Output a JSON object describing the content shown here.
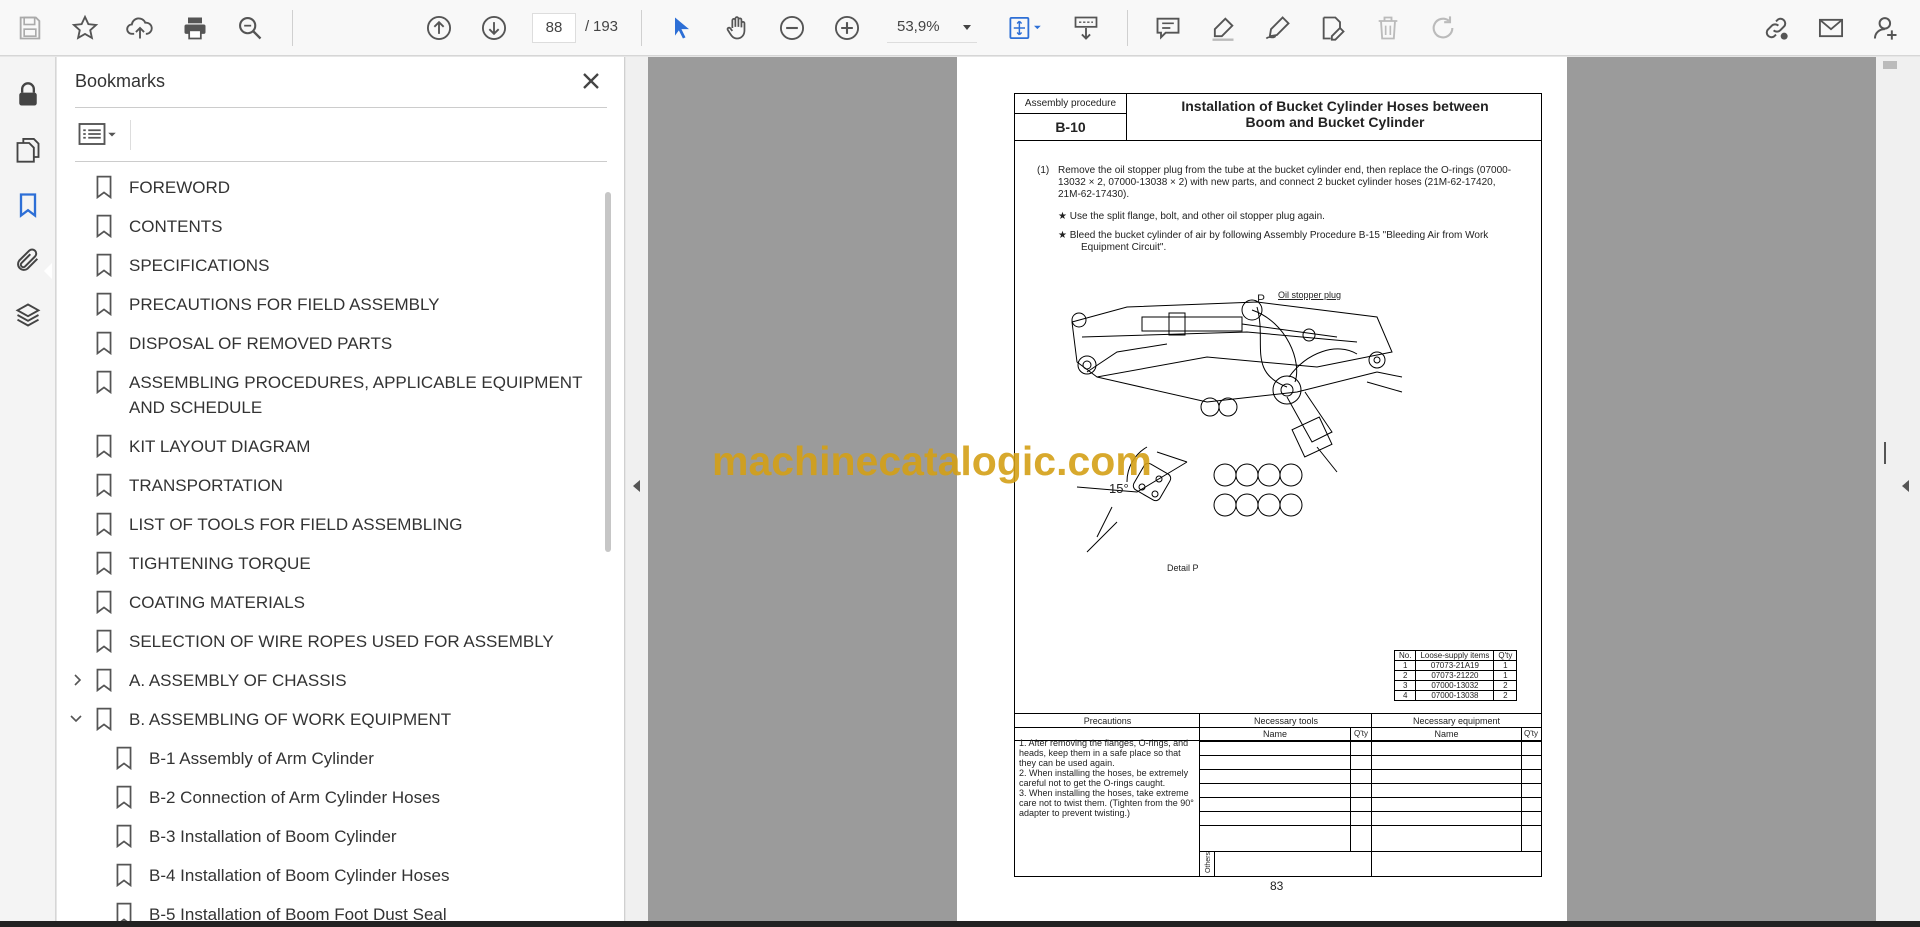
{
  "toolbar": {
    "page_current": "88",
    "page_separator": "/",
    "page_total": "193",
    "zoom": "53,9%",
    "icons": [
      "save-icon",
      "star-icon",
      "upload-icon",
      "print-icon",
      "zoom-search-icon",
      "page-up-icon",
      "page-down-icon",
      "zoom-out-icon",
      "zoom-in-icon",
      "select-arrow-icon",
      "hand-icon",
      "fit-page-icon",
      "scroll-mode-icon",
      "comment-icon",
      "highlight-icon",
      "sign-icon",
      "edit-icon",
      "delete-icon",
      "redo-icon",
      "share-link-icon",
      "email-icon",
      "account-icon"
    ]
  },
  "rail": {
    "icons": [
      "lock-icon",
      "pages-icon",
      "bookmark-icon",
      "attachment-icon",
      "layers-icon"
    ]
  },
  "bookmarks": {
    "title": "Bookmarks",
    "items": [
      {
        "label": "FOREWORD",
        "level": 0
      },
      {
        "label": "CONTENTS",
        "level": 0
      },
      {
        "label": "SPECIFICATIONS",
        "level": 0
      },
      {
        "label": "PRECAUTIONS FOR FIELD ASSEMBLY",
        "level": 0
      },
      {
        "label": "DISPOSAL OF REMOVED PARTS",
        "level": 0
      },
      {
        "label": "ASSEMBLING PROCEDURES, APPLICABLE EQUIPMENT AND SCHEDULE",
        "level": 0
      },
      {
        "label": "KIT LAYOUT DIAGRAM",
        "level": 0
      },
      {
        "label": "TRANSPORTATION",
        "level": 0
      },
      {
        "label": "LIST OF TOOLS FOR FIELD ASSEMBLING",
        "level": 0
      },
      {
        "label": "TIGHTENING TORQUE",
        "level": 0
      },
      {
        "label": "COATING MATERIALS",
        "level": 0
      },
      {
        "label": "SELECTION OF WIRE ROPES USED FOR ASSEMBLY",
        "level": 0
      },
      {
        "label": "A. ASSEMBLY OF CHASSIS",
        "level": 0,
        "toggle": "collapsed"
      },
      {
        "label": "B. ASSEMBLING OF WORK EQUIPMENT",
        "level": 0,
        "toggle": "expanded"
      },
      {
        "label": "B-1 Assembly of Arm Cylinder",
        "level": 1
      },
      {
        "label": "B-2 Connection of Arm Cylinder Hoses",
        "level": 1
      },
      {
        "label": "B-3 Installation of Boom Cylinder",
        "level": 1
      },
      {
        "label": "B-4 Installation of Boom Cylinder Hoses",
        "level": 1
      },
      {
        "label": "B-5 Installation of Boom Foot Dust Seal",
        "level": 1
      }
    ]
  },
  "document": {
    "header_label": "Assembly procedure",
    "header_code": "B-10",
    "header_title_1": "Installation of Bucket Cylinder Hoses between",
    "header_title_2": "Boom and Bucket Cylinder",
    "step_number": "(1)",
    "step_text": "Remove the oil stopper plug from the tube at the bucket cylinder end, then replace the O-rings (07000-13032 × 2, 07000-13038 × 2) with new parts, and connect 2 bucket cylinder hoses (21M-62-17420, 21M-62-17430).",
    "note1": "★   Use the split flange, bolt, and other oil stopper plug again.",
    "note2": "★   Bleed the bucket cylinder of air by following Assembly Procedure B-15 \"Bleeding Air from Work",
    "note2b": "Equipment Circuit\".",
    "fig_p": "P",
    "fig_oil_plug": "Oil stopper plug",
    "fig_angle": "15°",
    "fig_detail": "Detail P",
    "watermark": "machinecatalogic.com",
    "parts_table": {
      "headers": [
        "No.",
        "Loose-supply items",
        "Q'ty"
      ],
      "rows": [
        [
          "1",
          "07073-21A19",
          "1"
        ],
        [
          "2",
          "07073-21220",
          "1"
        ],
        [
          "3",
          "07000-13032",
          "2"
        ],
        [
          "4",
          "07000-13038",
          "2"
        ]
      ]
    },
    "precautions_head": "Precautions",
    "tools_head": "Necessary tools",
    "equipment_head": "Necessary equipment",
    "name_head": "Name",
    "qty_head": "Q'ty",
    "others": "Others",
    "precautions": [
      "1. After removing the flanges, O-rings, and heads, keep them in a safe place so that they can be used again.",
      "2. When installing the hoses, be extremely careful not to get the O-rings caught.",
      "3. When installing the hoses, take extreme care not to twist them. (Tighten from the 90° adapter to prevent twisting.)"
    ],
    "page_number": "83"
  }
}
